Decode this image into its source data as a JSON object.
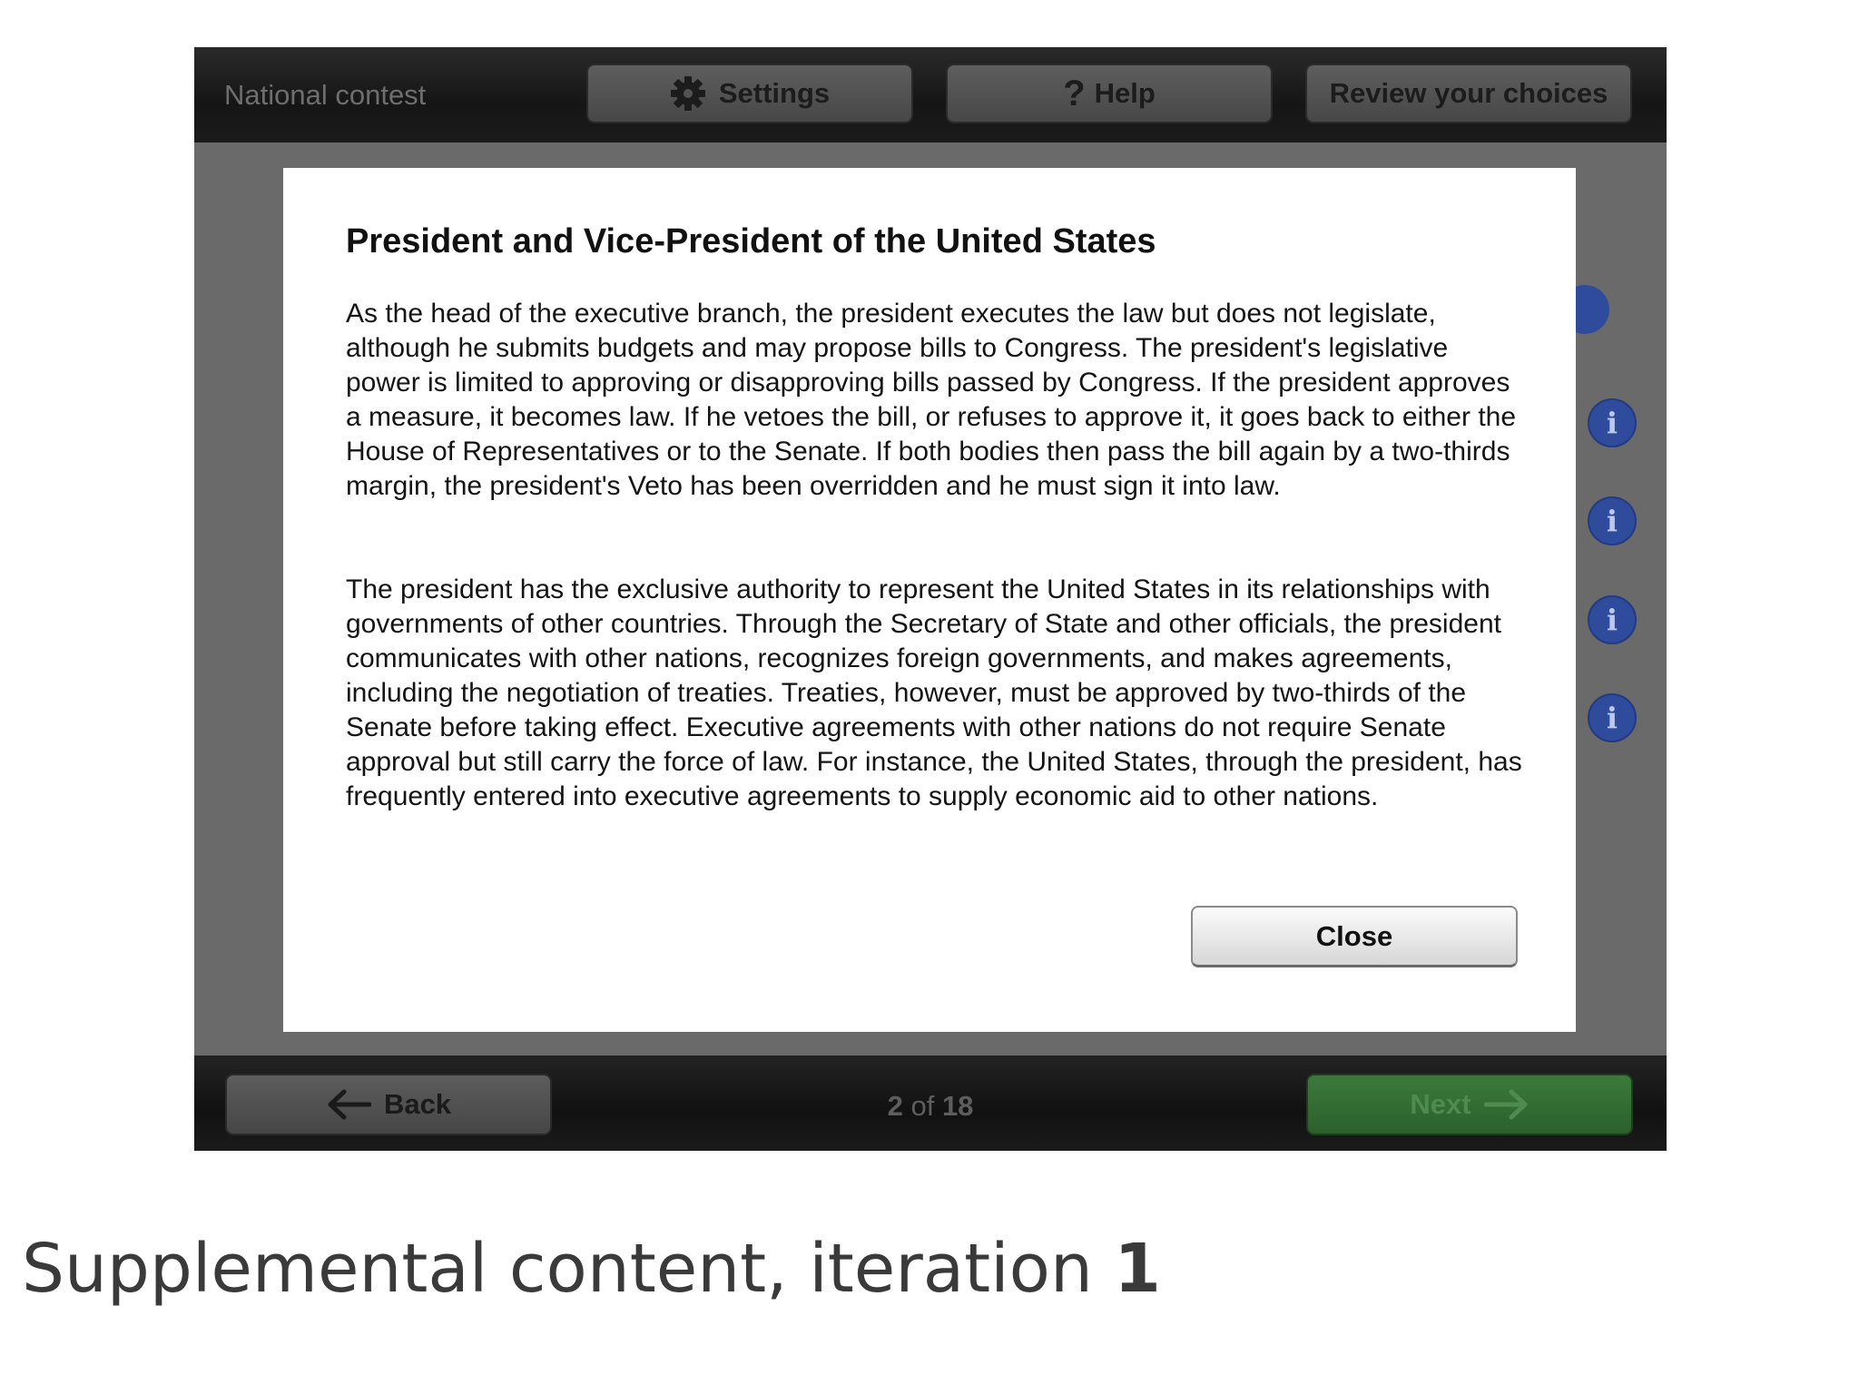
{
  "header": {
    "contest_label": "National contest",
    "settings_label": "Settings",
    "help_label": "Help",
    "review_label": "Review your choices"
  },
  "modal": {
    "title": "President and Vice-President of the United States",
    "paragraphs": [
      "As the head of the executive branch, the president executes the law but does not legislate, although he submits budgets and may propose bills to Congress. The president's legislative power is limited to approving or disapproving bills passed by Congress. If the president approves a measure, it becomes law. If he vetoes the bill, or refuses to approve it, it goes back to either the House of Representatives or to the Senate. If both bodies then pass the bill again by a two-thirds margin, the president's Veto has been overridden and he must sign it into law.",
      "The president has the exclusive authority to represent the United States in its relationships with governments of other countries. Through the Secretary of State and other officials, the president communicates with other nations, recognizes foreign governments, and makes agreements, including the negotiation of treaties. Treaties, however, must be approved by two-thirds of the Senate before taking effect. Executive agreements with other nations do not require Senate approval but still carry the force of law. For instance, the United States, through the president, has frequently entered into executive agreements to supply economic aid to other nations."
    ],
    "close_label": "Close"
  },
  "info_icon_glyph": "i",
  "footer": {
    "back_label": "Back",
    "page_current": "2",
    "page_of": "of",
    "page_total": "18",
    "next_label": "Next"
  },
  "caption": {
    "text": "Supplemental content, iteration",
    "number": "1"
  },
  "colors": {
    "info_blue": "#2f4b9c",
    "next_green": "#2c602c",
    "bar_dark": "#151515",
    "content_gray": "#6a6a6a"
  }
}
